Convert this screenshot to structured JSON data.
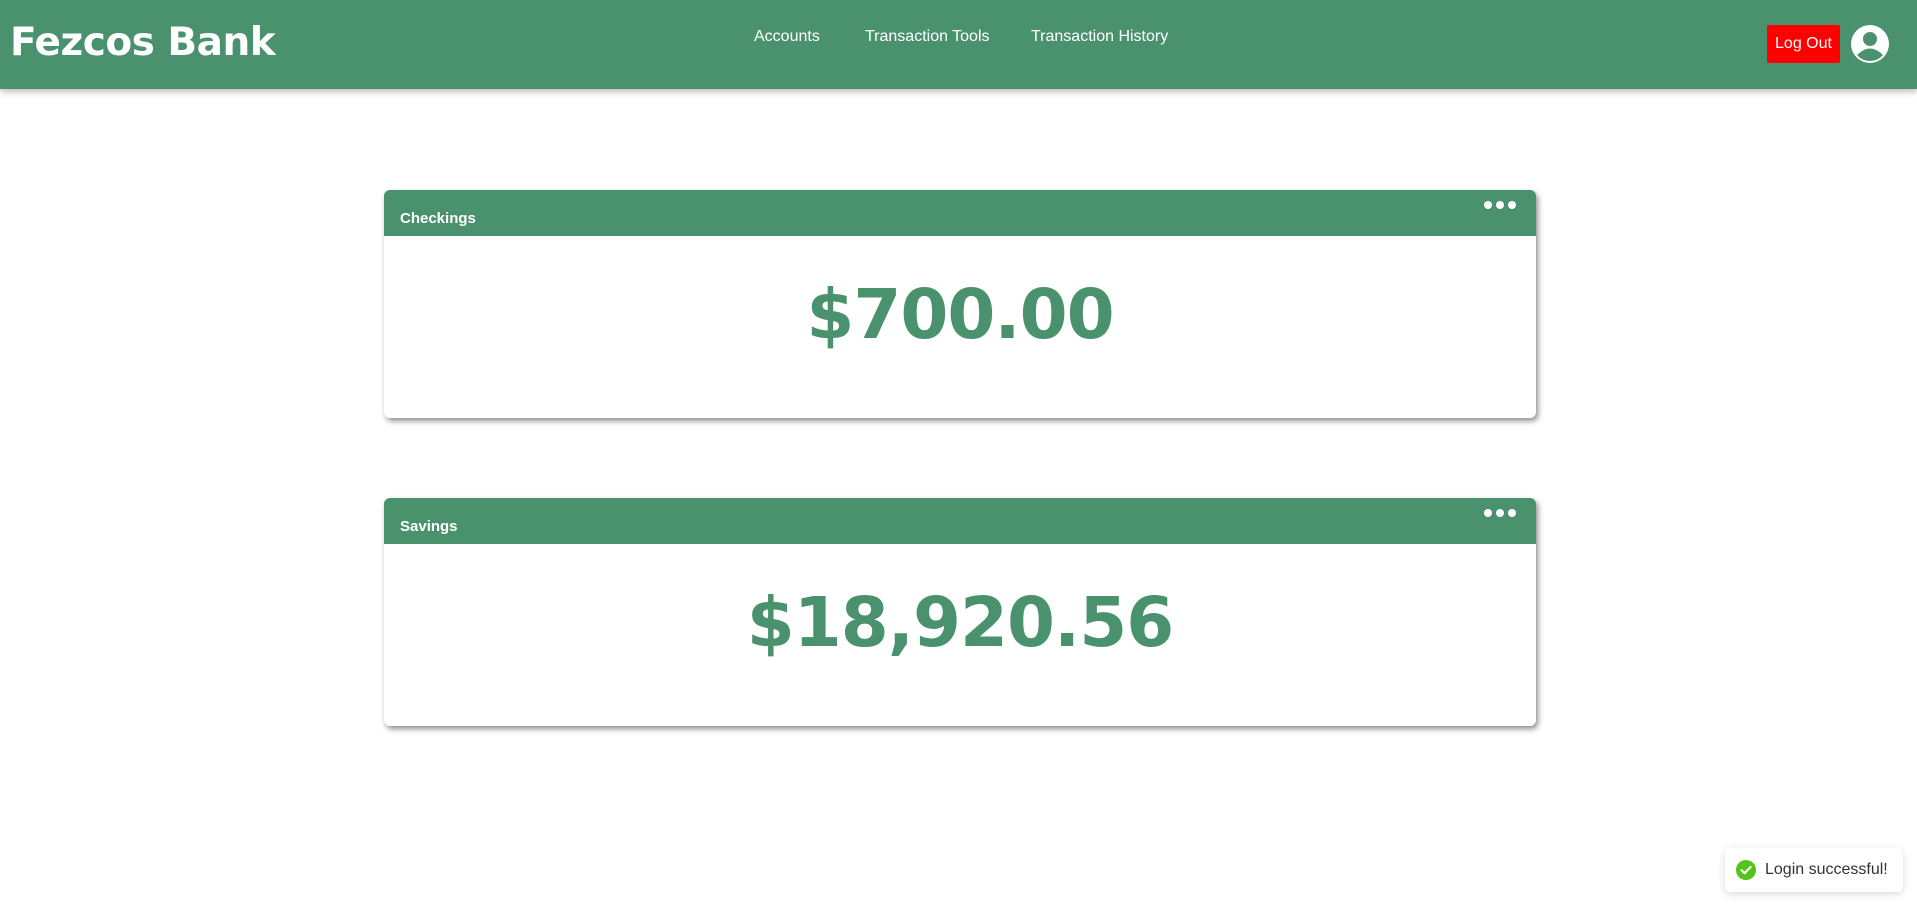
{
  "navbar": {
    "brand": "Fezcos Bank",
    "links": [
      "Accounts",
      "Transaction Tools",
      "Transaction History"
    ],
    "logout_label": "Log Out",
    "color": "#4a926d",
    "logout_color": "#ff0000"
  },
  "accounts": [
    {
      "name": "Checkings",
      "balance": "$700.00"
    },
    {
      "name": "Savings",
      "balance": "$18,920.56"
    }
  ],
  "toast": {
    "message": "Login successful!",
    "icon": "check-circle-icon",
    "color": "#52c41a"
  },
  "icons": {
    "user": "user-circle-icon",
    "more": "ellipsis-icon"
  }
}
